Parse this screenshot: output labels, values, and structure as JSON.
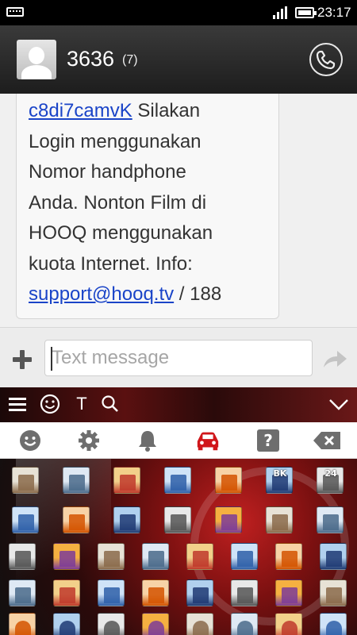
{
  "status_bar": {
    "time": "23:17"
  },
  "header": {
    "contact_name": "3636",
    "message_count": "(7)"
  },
  "message": {
    "lines": [
      {
        "link": "c8di7camvK",
        "text": " Silakan"
      },
      {
        "text": "Login menggunakan"
      },
      {
        "text": "Nomor handphone"
      },
      {
        "text": "Anda. Nonton Film di"
      },
      {
        "text": "HOOQ menggunakan"
      },
      {
        "text": "kuota Internet. Info:"
      },
      {
        "link": "support@hooq.tv",
        "text": " / 188"
      }
    ]
  },
  "input": {
    "placeholder": "Text message"
  },
  "colors": {
    "accent": "#d0161a",
    "link": "#1a44c8",
    "header_bg": "#2c2c2c"
  },
  "keyboard_toolbar": {
    "icons": [
      "menu-icon",
      "smiley-icon",
      "text-style-icon",
      "search-icon",
      "collapse-icon"
    ],
    "text_style_label": "T"
  },
  "emoji_categories": [
    {
      "icon": "face-icon",
      "selected": false
    },
    {
      "icon": "gear-icon",
      "selected": false
    },
    {
      "icon": "bell-icon",
      "selected": false
    },
    {
      "icon": "car-icon",
      "selected": true
    },
    {
      "icon": "symbols-icon",
      "selected": false,
      "label": "?"
    },
    {
      "icon": "backspace-icon",
      "selected": false
    }
  ],
  "emoji_grid": {
    "rows": [
      [
        {
          "name": "house-icon"
        },
        {
          "name": "house-garden-icon"
        },
        {
          "name": "office-icon"
        },
        {
          "name": "japanese-post-office-icon"
        },
        {
          "name": "hospital-icon"
        },
        {
          "name": "bank-icon",
          "label": "BK"
        },
        {
          "name": "convenience-store-icon",
          "label": "24"
        }
      ],
      [
        {
          "name": "love-hotel-icon"
        },
        {
          "name": "hotel-icon"
        },
        {
          "name": "school-icon"
        },
        {
          "name": "department-store-icon"
        },
        {
          "name": "factory-icon"
        },
        {
          "name": "sunset-icon"
        },
        {
          "name": "city-dusk-icon"
        }
      ],
      [
        {
          "name": "japanese-castle-icon"
        },
        {
          "name": "european-castle-icon"
        },
        {
          "name": "tent-icon"
        },
        {
          "name": "factory-icon"
        },
        {
          "name": "tokyo-tower-icon"
        },
        {
          "name": "japan-map-icon"
        },
        {
          "name": "mount-fuji-icon"
        },
        {
          "name": "sunrise-mountains-icon"
        }
      ],
      [
        {
          "name": "sunrise-icon"
        },
        {
          "name": "night-stars-icon"
        },
        {
          "name": "statue-of-liberty-icon"
        },
        {
          "name": "bridge-night-icon"
        },
        {
          "name": "carousel-icon"
        },
        {
          "name": "ferris-wheel-icon"
        },
        {
          "name": "fountain-icon"
        },
        {
          "name": "roller-coaster-icon"
        }
      ],
      [
        {
          "name": "ship-icon"
        },
        {
          "name": "sailboat-icon"
        },
        {
          "name": "speedboat-icon"
        },
        {
          "name": "rowboat-icon"
        },
        {
          "name": "rocket-icon"
        },
        {
          "name": "airplane-icon"
        },
        {
          "name": "anchor-icon"
        },
        {
          "name": "seat-icon"
        }
      ]
    ]
  }
}
